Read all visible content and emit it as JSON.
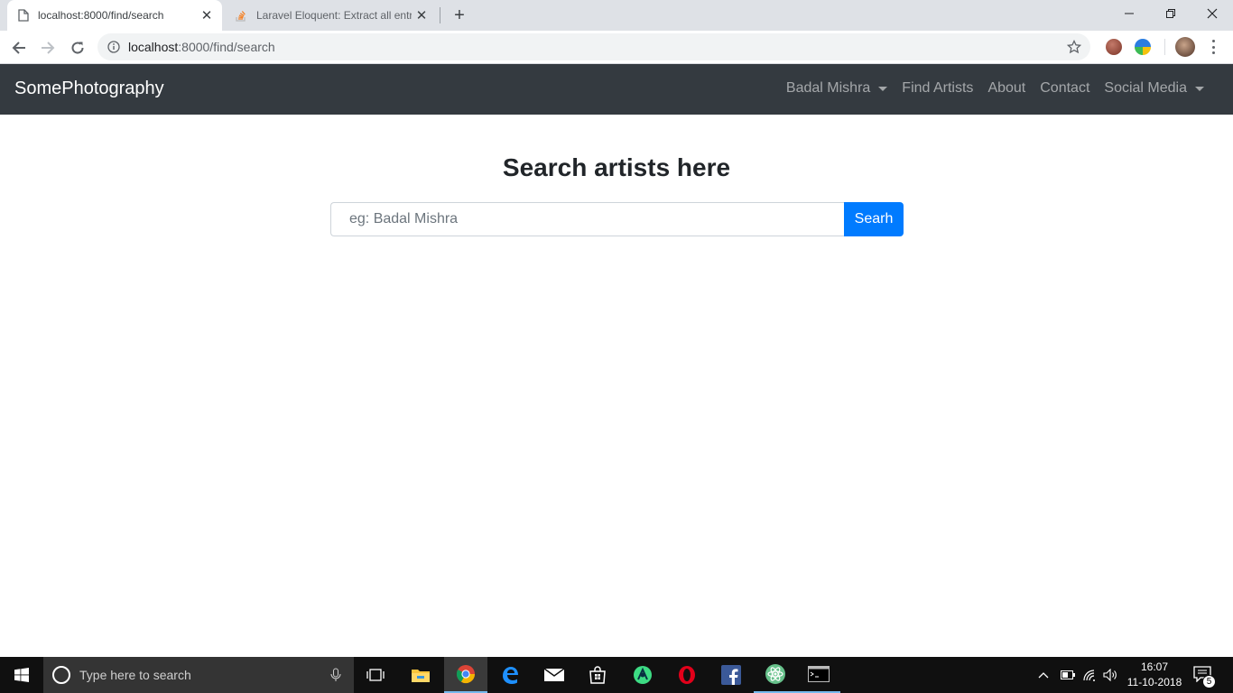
{
  "browser": {
    "tabs": [
      {
        "title": "localhost:8000/find/search",
        "active": true
      },
      {
        "title": "Laravel Eloquent: Extract all entries",
        "active": false
      }
    ],
    "new_tab_label": "+",
    "url_host": "localhost",
    "url_rest": ":8000/find/search"
  },
  "navbar": {
    "brand": "SomePhotography",
    "links": [
      {
        "label": "Badal Mishra",
        "dropdown": true
      },
      {
        "label": "Find Artists",
        "dropdown": false
      },
      {
        "label": "About",
        "dropdown": false
      },
      {
        "label": "Contact",
        "dropdown": false
      },
      {
        "label": "Social Media",
        "dropdown": true
      }
    ]
  },
  "main": {
    "heading": "Search artists here",
    "search_placeholder": "eg: Badal Mishra",
    "search_value": "",
    "search_button": "Searh"
  },
  "taskbar": {
    "search_placeholder": "Type here to search",
    "time": "16:07",
    "date": "11-10-2018",
    "notification_count": "5"
  },
  "colors": {
    "navbar_bg": "#343a40",
    "primary": "#007bff",
    "taskbar_bg": "#101010"
  }
}
